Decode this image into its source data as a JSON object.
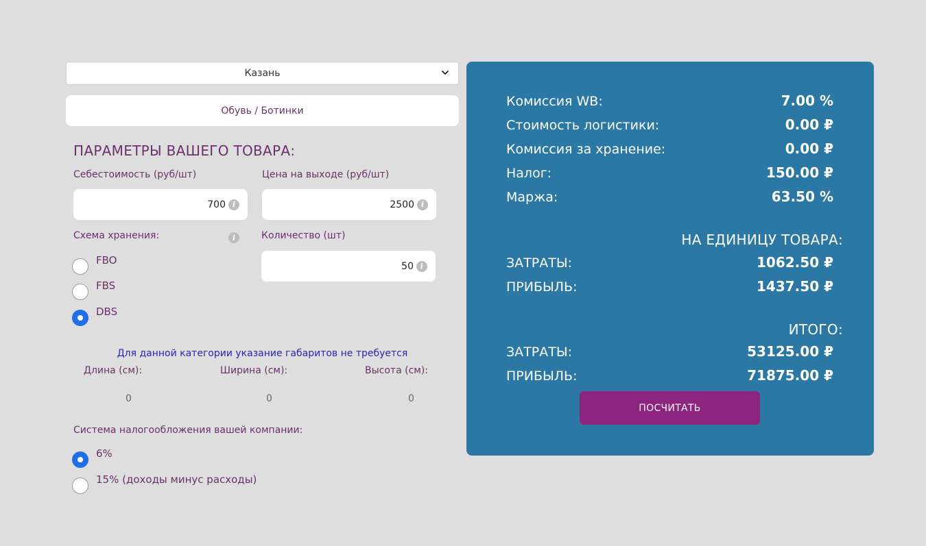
{
  "city_select": {
    "value": "Казань"
  },
  "category": {
    "value": "Обувь / Ботинки"
  },
  "params": {
    "title": "ПАРАМЕТРЫ ВАШЕГО ТОВАРА:",
    "cost_label": "Себестоимость (руб/шт)",
    "cost_value": "700",
    "price_label": "Цена на выходе (руб/шт)",
    "price_value": "2500",
    "storage_label": "Схема хранения:",
    "quantity_label": "Количество (шт)",
    "quantity_value": "50",
    "info_glyph": "i"
  },
  "storage_options": [
    {
      "label": "FBO",
      "checked": false
    },
    {
      "label": "FBS",
      "checked": false
    },
    {
      "label": "DBS",
      "checked": true
    }
  ],
  "dimensions": {
    "note": "Для данной категории указание габаритов не требуется",
    "length_label": "Длина (см):",
    "width_label": "Ширина (см):",
    "height_label": "Высота (см):",
    "length_value": "0",
    "width_value": "0",
    "height_value": "0"
  },
  "tax": {
    "label": "Система налогообложения вашей компании:",
    "options": [
      {
        "label": "6%",
        "checked": true
      },
      {
        "label": "15% (доходы минус расходы)",
        "checked": false
      }
    ]
  },
  "results": {
    "commission_label": "Комиссия WB:",
    "commission_value": "7.00 %",
    "logistics_label": "Стоимость логистики:",
    "logistics_value": "0.00 ₽",
    "storage_fee_label": "Комиссия за хранение:",
    "storage_fee_value": "0.00 ₽",
    "tax_label": "Налог:",
    "tax_value": "150.00 ₽",
    "margin_label": "Маржа:",
    "margin_value": "63.50 %",
    "per_unit_title": "НА ЕДИНИЦУ ТОВАРА:",
    "unit_costs_label": "ЗАТРАТЫ:",
    "unit_costs_value": "1062.50 ₽",
    "unit_profit_label": "ПРИБЫЛЬ:",
    "unit_profit_value": "1437.50 ₽",
    "total_title": "ИТОГО:",
    "total_costs_label": "ЗАТРАТЫ:",
    "total_costs_value": "53125.00 ₽",
    "total_profit_label": "ПРИБЫЛЬ:",
    "total_profit_value": "71875.00 ₽",
    "calc_button": "ПОСЧИТАТЬ"
  },
  "colors": {
    "background": "#dedede",
    "panel": "#2a78a3",
    "accent_text": "#6b2f6b",
    "button": "#8d2580",
    "radio_checked": "#1f6fe5"
  }
}
